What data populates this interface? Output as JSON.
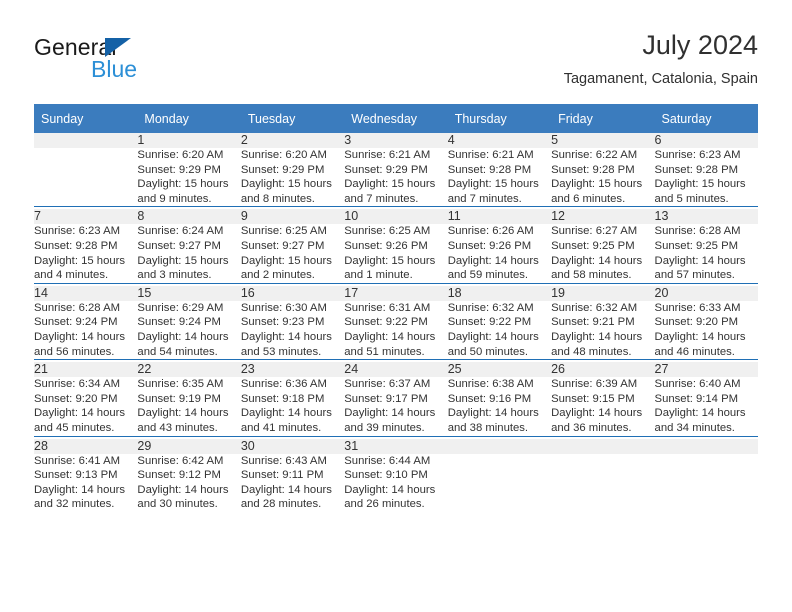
{
  "brand": {
    "name_top": "General",
    "name_bottom": "Blue",
    "triangle_color": "#1461A6",
    "blue_text_color": "#2C8FD6"
  },
  "header": {
    "title": "July 2024",
    "location": "Tagamanent, Catalonia, Spain"
  },
  "theme": {
    "header_bg": "#3B7CBE",
    "header_text": "#FFFFFF",
    "daynum_bg": "#F0F0F0",
    "row_separator": "#1F6FB5",
    "body_text": "#333333"
  },
  "weekdays": [
    "Sunday",
    "Monday",
    "Tuesday",
    "Wednesday",
    "Thursday",
    "Friday",
    "Saturday"
  ],
  "labels": {
    "sunrise": "Sunrise:",
    "sunset": "Sunset:",
    "daylight": "Daylight:"
  },
  "weeks": [
    [
      {
        "day": "",
        "blank": true
      },
      {
        "day": "1",
        "sunrise": "Sunrise: 6:20 AM",
        "sunset": "Sunset: 9:29 PM",
        "daylight1": "Daylight: 15 hours",
        "daylight2": "and 9 minutes."
      },
      {
        "day": "2",
        "sunrise": "Sunrise: 6:20 AM",
        "sunset": "Sunset: 9:29 PM",
        "daylight1": "Daylight: 15 hours",
        "daylight2": "and 8 minutes."
      },
      {
        "day": "3",
        "sunrise": "Sunrise: 6:21 AM",
        "sunset": "Sunset: 9:29 PM",
        "daylight1": "Daylight: 15 hours",
        "daylight2": "and 7 minutes."
      },
      {
        "day": "4",
        "sunrise": "Sunrise: 6:21 AM",
        "sunset": "Sunset: 9:28 PM",
        "daylight1": "Daylight: 15 hours",
        "daylight2": "and 7 minutes."
      },
      {
        "day": "5",
        "sunrise": "Sunrise: 6:22 AM",
        "sunset": "Sunset: 9:28 PM",
        "daylight1": "Daylight: 15 hours",
        "daylight2": "and 6 minutes."
      },
      {
        "day": "6",
        "sunrise": "Sunrise: 6:23 AM",
        "sunset": "Sunset: 9:28 PM",
        "daylight1": "Daylight: 15 hours",
        "daylight2": "and 5 minutes."
      }
    ],
    [
      {
        "day": "7",
        "sunrise": "Sunrise: 6:23 AM",
        "sunset": "Sunset: 9:28 PM",
        "daylight1": "Daylight: 15 hours",
        "daylight2": "and 4 minutes."
      },
      {
        "day": "8",
        "sunrise": "Sunrise: 6:24 AM",
        "sunset": "Sunset: 9:27 PM",
        "daylight1": "Daylight: 15 hours",
        "daylight2": "and 3 minutes."
      },
      {
        "day": "9",
        "sunrise": "Sunrise: 6:25 AM",
        "sunset": "Sunset: 9:27 PM",
        "daylight1": "Daylight: 15 hours",
        "daylight2": "and 2 minutes."
      },
      {
        "day": "10",
        "sunrise": "Sunrise: 6:25 AM",
        "sunset": "Sunset: 9:26 PM",
        "daylight1": "Daylight: 15 hours",
        "daylight2": "and 1 minute."
      },
      {
        "day": "11",
        "sunrise": "Sunrise: 6:26 AM",
        "sunset": "Sunset: 9:26 PM",
        "daylight1": "Daylight: 14 hours",
        "daylight2": "and 59 minutes."
      },
      {
        "day": "12",
        "sunrise": "Sunrise: 6:27 AM",
        "sunset": "Sunset: 9:25 PM",
        "daylight1": "Daylight: 14 hours",
        "daylight2": "and 58 minutes."
      },
      {
        "day": "13",
        "sunrise": "Sunrise: 6:28 AM",
        "sunset": "Sunset: 9:25 PM",
        "daylight1": "Daylight: 14 hours",
        "daylight2": "and 57 minutes."
      }
    ],
    [
      {
        "day": "14",
        "sunrise": "Sunrise: 6:28 AM",
        "sunset": "Sunset: 9:24 PM",
        "daylight1": "Daylight: 14 hours",
        "daylight2": "and 56 minutes."
      },
      {
        "day": "15",
        "sunrise": "Sunrise: 6:29 AM",
        "sunset": "Sunset: 9:24 PM",
        "daylight1": "Daylight: 14 hours",
        "daylight2": "and 54 minutes."
      },
      {
        "day": "16",
        "sunrise": "Sunrise: 6:30 AM",
        "sunset": "Sunset: 9:23 PM",
        "daylight1": "Daylight: 14 hours",
        "daylight2": "and 53 minutes."
      },
      {
        "day": "17",
        "sunrise": "Sunrise: 6:31 AM",
        "sunset": "Sunset: 9:22 PM",
        "daylight1": "Daylight: 14 hours",
        "daylight2": "and 51 minutes."
      },
      {
        "day": "18",
        "sunrise": "Sunrise: 6:32 AM",
        "sunset": "Sunset: 9:22 PM",
        "daylight1": "Daylight: 14 hours",
        "daylight2": "and 50 minutes."
      },
      {
        "day": "19",
        "sunrise": "Sunrise: 6:32 AM",
        "sunset": "Sunset: 9:21 PM",
        "daylight1": "Daylight: 14 hours",
        "daylight2": "and 48 minutes."
      },
      {
        "day": "20",
        "sunrise": "Sunrise: 6:33 AM",
        "sunset": "Sunset: 9:20 PM",
        "daylight1": "Daylight: 14 hours",
        "daylight2": "and 46 minutes."
      }
    ],
    [
      {
        "day": "21",
        "sunrise": "Sunrise: 6:34 AM",
        "sunset": "Sunset: 9:20 PM",
        "daylight1": "Daylight: 14 hours",
        "daylight2": "and 45 minutes."
      },
      {
        "day": "22",
        "sunrise": "Sunrise: 6:35 AM",
        "sunset": "Sunset: 9:19 PM",
        "daylight1": "Daylight: 14 hours",
        "daylight2": "and 43 minutes."
      },
      {
        "day": "23",
        "sunrise": "Sunrise: 6:36 AM",
        "sunset": "Sunset: 9:18 PM",
        "daylight1": "Daylight: 14 hours",
        "daylight2": "and 41 minutes."
      },
      {
        "day": "24",
        "sunrise": "Sunrise: 6:37 AM",
        "sunset": "Sunset: 9:17 PM",
        "daylight1": "Daylight: 14 hours",
        "daylight2": "and 39 minutes."
      },
      {
        "day": "25",
        "sunrise": "Sunrise: 6:38 AM",
        "sunset": "Sunset: 9:16 PM",
        "daylight1": "Daylight: 14 hours",
        "daylight2": "and 38 minutes."
      },
      {
        "day": "26",
        "sunrise": "Sunrise: 6:39 AM",
        "sunset": "Sunset: 9:15 PM",
        "daylight1": "Daylight: 14 hours",
        "daylight2": "and 36 minutes."
      },
      {
        "day": "27",
        "sunrise": "Sunrise: 6:40 AM",
        "sunset": "Sunset: 9:14 PM",
        "daylight1": "Daylight: 14 hours",
        "daylight2": "and 34 minutes."
      }
    ],
    [
      {
        "day": "28",
        "sunrise": "Sunrise: 6:41 AM",
        "sunset": "Sunset: 9:13 PM",
        "daylight1": "Daylight: 14 hours",
        "daylight2": "and 32 minutes."
      },
      {
        "day": "29",
        "sunrise": "Sunrise: 6:42 AM",
        "sunset": "Sunset: 9:12 PM",
        "daylight1": "Daylight: 14 hours",
        "daylight2": "and 30 minutes."
      },
      {
        "day": "30",
        "sunrise": "Sunrise: 6:43 AM",
        "sunset": "Sunset: 9:11 PM",
        "daylight1": "Daylight: 14 hours",
        "daylight2": "and 28 minutes."
      },
      {
        "day": "31",
        "sunrise": "Sunrise: 6:44 AM",
        "sunset": "Sunset: 9:10 PM",
        "daylight1": "Daylight: 14 hours",
        "daylight2": "and 26 minutes."
      },
      {
        "day": "",
        "blank": true
      },
      {
        "day": "",
        "blank": true
      },
      {
        "day": "",
        "blank": true
      }
    ]
  ]
}
